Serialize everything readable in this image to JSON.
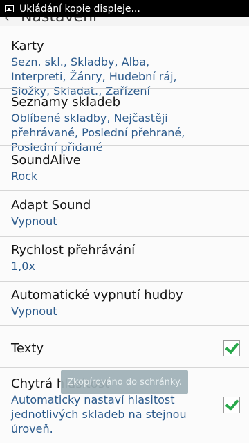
{
  "status_bar": {
    "notification_text": "Ukládání kopie displeje..."
  },
  "header": {
    "title": "Nastavení"
  },
  "settings": [
    {
      "title": "Karty",
      "subtitle": "Sezn. skl., Skladby, Alba, Interpreti, Žánry, Hudební ráj, Složky, Skladat., Zařízení"
    },
    {
      "title": "Seznamy skladeb",
      "subtitle": "Oblíbené skladby, Nejčastěji přehrávané, Poslední přehrané, Poslední přidané"
    },
    {
      "title": "SoundAlive",
      "subtitle": "Rock"
    },
    {
      "title": "Adapt Sound",
      "subtitle": "Vypnout"
    },
    {
      "title": "Rychlost přehrávání",
      "subtitle": "1,0x"
    },
    {
      "title": "Automatické vypnutí hudby",
      "subtitle": "Vypnout"
    },
    {
      "title": "Texty",
      "checked": true
    },
    {
      "title": "Chytrá hlasitost",
      "subtitle": "Automaticky nastaví hlasitost jednotlivých skladeb na stejnou úroveň.",
      "checked": true
    }
  ],
  "toast": {
    "text": "Zkopírováno do schránky."
  },
  "colors": {
    "accent_check": "#27a84a",
    "subtitle_text": "#2b5a8c"
  }
}
